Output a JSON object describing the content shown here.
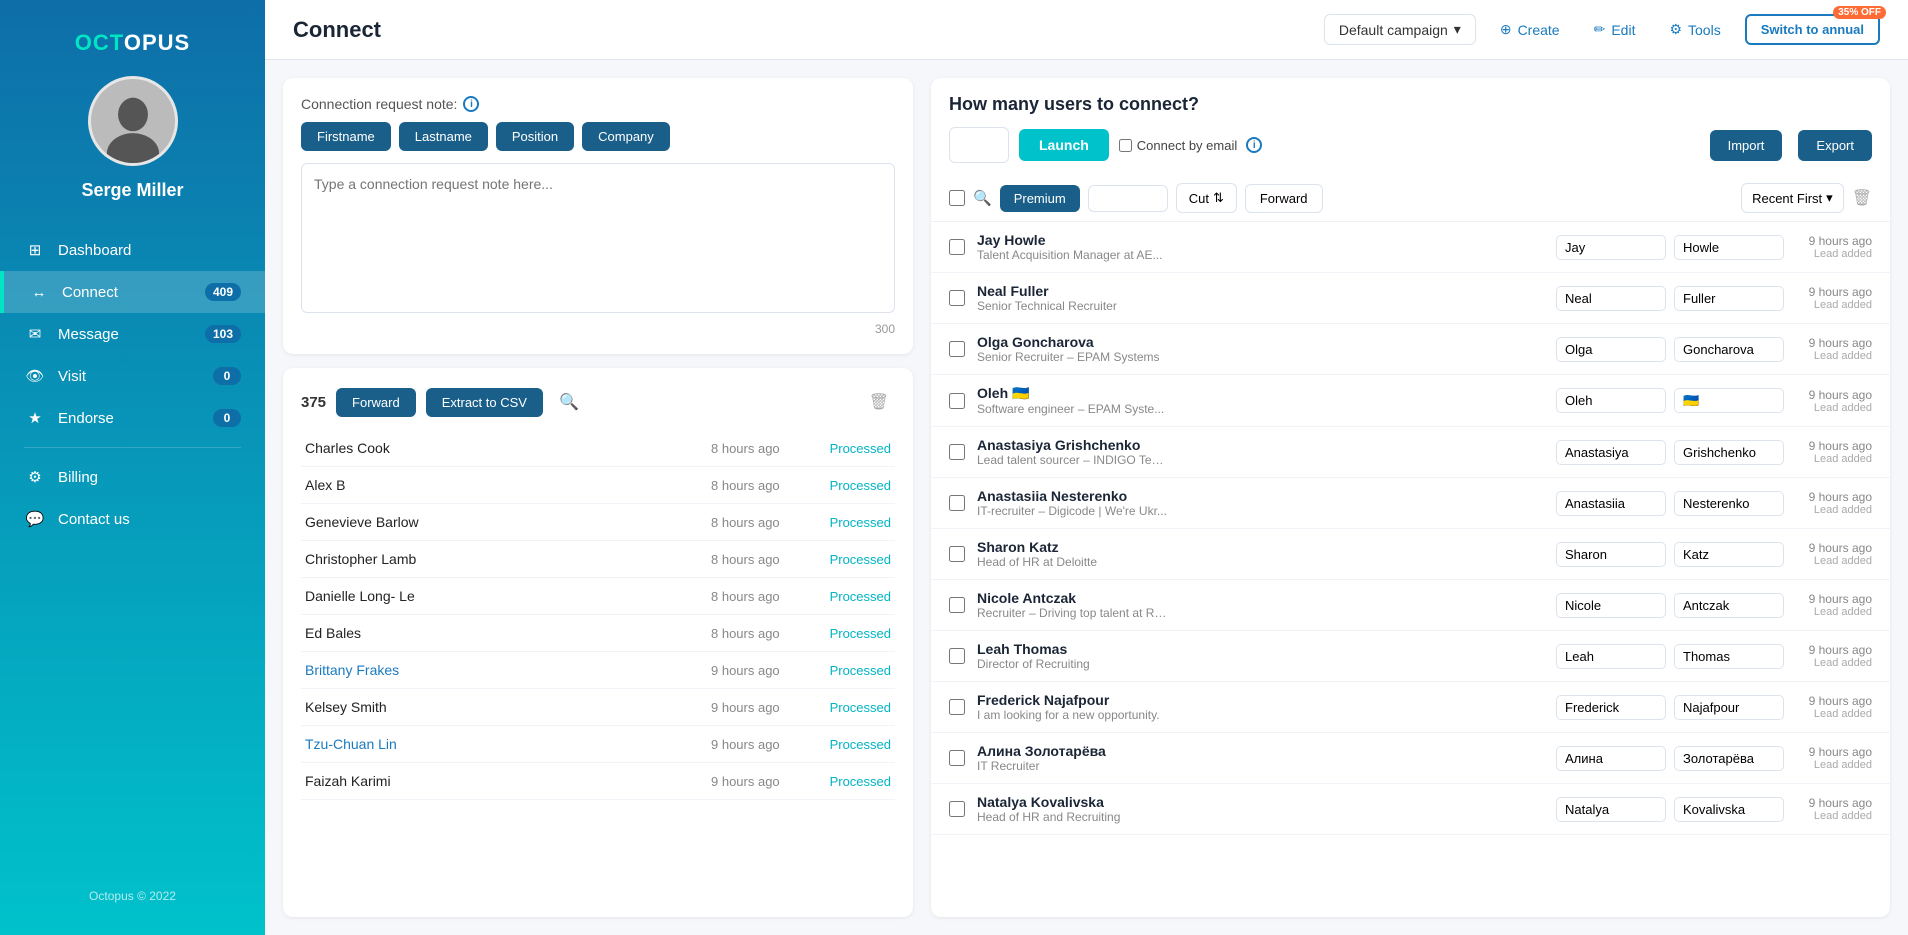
{
  "sidebar": {
    "logo": "OCTOPUS",
    "username": "Serge Miller",
    "nav": [
      {
        "id": "dashboard",
        "label": "Dashboard",
        "icon": "dashboard",
        "badge": null,
        "active": false
      },
      {
        "id": "connect",
        "label": "Connect",
        "icon": "connect",
        "badge": "409",
        "active": true
      },
      {
        "id": "message",
        "label": "Message",
        "icon": "message",
        "badge": "103",
        "active": false
      },
      {
        "id": "visit",
        "label": "Visit",
        "icon": "visit",
        "badge": "0",
        "active": false
      },
      {
        "id": "endorse",
        "label": "Endorse",
        "icon": "endorse",
        "badge": "0",
        "active": false
      }
    ],
    "nav2": [
      {
        "id": "billing",
        "label": "Billing",
        "icon": "billing"
      },
      {
        "id": "contact",
        "label": "Contact us",
        "icon": "contact"
      }
    ],
    "footer": "Octopus © 2022"
  },
  "topbar": {
    "title": "Connect",
    "campaign": "Default campaign",
    "create_label": "Create",
    "edit_label": "Edit",
    "tools_label": "Tools",
    "switch_label": "Switch to annual",
    "discount": "35% OFF"
  },
  "left": {
    "note_label": "Connection request note:",
    "tag_buttons": [
      "Firstname",
      "Lastname",
      "Position",
      "Company"
    ],
    "textarea_placeholder": "Type a connection request note here...",
    "char_count": "300",
    "list_count": "375",
    "forward_btn": "Forward",
    "extract_btn": "Extract to CSV",
    "rows": [
      {
        "name": "Charles Cook",
        "highlighted": false,
        "time": "8 hours ago",
        "status": "Processed"
      },
      {
        "name": "Alex B",
        "highlighted": false,
        "time": "8 hours ago",
        "status": "Processed"
      },
      {
        "name": "Genevieve Barlow",
        "highlighted": false,
        "time": "8 hours ago",
        "status": "Processed"
      },
      {
        "name": "Christopher Lamb",
        "highlighted": false,
        "time": "8 hours ago",
        "status": "Processed"
      },
      {
        "name": "Danielle Long- Le",
        "highlighted": false,
        "time": "8 hours ago",
        "status": "Processed"
      },
      {
        "name": "Ed Bales",
        "highlighted": false,
        "time": "8 hours ago",
        "status": "Processed"
      },
      {
        "name": "Brittany Frakes",
        "highlighted": true,
        "time": "9 hours ago",
        "status": "Processed"
      },
      {
        "name": "Kelsey Smith",
        "highlighted": false,
        "time": "9 hours ago",
        "status": "Processed"
      },
      {
        "name": "Tzu-Chuan Lin",
        "highlighted": true,
        "time": "9 hours ago",
        "status": "Processed"
      },
      {
        "name": "Faizah Karimi",
        "highlighted": false,
        "time": "9 hours ago",
        "status": "Processed"
      }
    ]
  },
  "right": {
    "how_many_label": "How many users to connect?",
    "launch_input_val": "",
    "launch_btn": "Launch",
    "connect_email_label": "Connect by email",
    "import_btn": "Import",
    "export_btn": "Export",
    "filter": {
      "premium_label": "Premium",
      "cut_label": "Cut",
      "forward_label": "Forward",
      "sort_label": "Recent First"
    },
    "contacts": [
      {
        "name": "Jay Howle",
        "sub": "Talent Acquisition Manager at AE...",
        "first": "Jay",
        "last": "Howle",
        "time": "9 hours ago",
        "time_label": "Lead added"
      },
      {
        "name": "Neal Fuller",
        "sub": "Senior Technical Recruiter",
        "first": "Neal",
        "last": "Fuller",
        "time": "9 hours ago",
        "time_label": "Lead added"
      },
      {
        "name": "Olga Goncharova",
        "sub": "Senior Recruiter – EPAM Systems",
        "first": "Olga",
        "last": "Goncharova",
        "time": "9 hours ago",
        "time_label": "Lead added"
      },
      {
        "name": "Oleh 🇺🇦",
        "sub": "Software engineer – EPAM Syste...",
        "first": "Oleh",
        "last": "🇺🇦",
        "time": "9 hours ago",
        "time_label": "Lead added"
      },
      {
        "name": "Anastasiya Grishchenko",
        "sub": "Lead talent sourcer – INDIGO Tec...",
        "first": "Anastasiya",
        "last": "Grishchenko",
        "time": "9 hours ago",
        "time_label": "Lead added"
      },
      {
        "name": "Anastasiia Nesterenko",
        "sub": "IT-recruiter – Digicode | We're Ukr...",
        "first": "Anastasiia",
        "last": "Nesterenko",
        "time": "9 hours ago",
        "time_label": "Lead added"
      },
      {
        "name": "Sharon Katz",
        "sub": "Head of HR at Deloitte",
        "first": "Sharon",
        "last": "Katz",
        "time": "9 hours ago",
        "time_label": "Lead added"
      },
      {
        "name": "Nicole Antczak",
        "sub": "Recruiter – Driving top talent at Ri...",
        "first": "Nicole",
        "last": "Antczak",
        "time": "9 hours ago",
        "time_label": "Lead added"
      },
      {
        "name": "Leah Thomas",
        "sub": "Director of Recruiting",
        "first": "Leah",
        "last": "Thomas",
        "time": "9 hours ago",
        "time_label": "Lead added"
      },
      {
        "name": "Frederick Najafpour",
        "sub": "I am looking for a new opportunity.",
        "first": "Frederick",
        "last": "Najafpour",
        "time": "9 hours ago",
        "time_label": "Lead added"
      },
      {
        "name": "Алина Золотарёва",
        "sub": "IT Recruiter",
        "first": "Алина",
        "last": "Золотарёва",
        "time": "9 hours ago",
        "time_label": "Lead added"
      },
      {
        "name": "Natalya Kovalivska",
        "sub": "Head of HR and Recruiting",
        "first": "Natalya",
        "last": "Kovalivska",
        "time": "9 hours ago",
        "time_label": "Lead added"
      }
    ]
  }
}
